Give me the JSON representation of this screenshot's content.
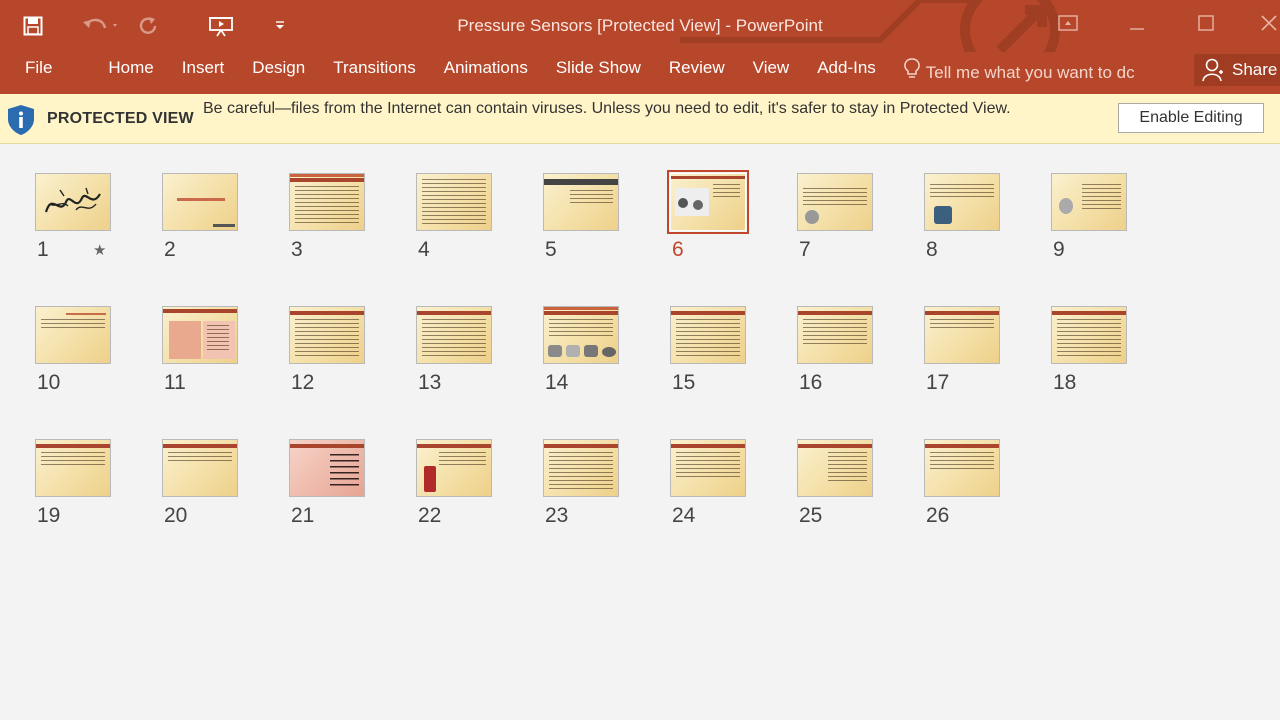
{
  "window": {
    "title": "Pressure Sensors [Protected View] - PowerPoint"
  },
  "ribbon": {
    "tabs": [
      "File",
      "Home",
      "Insert",
      "Design",
      "Transitions",
      "Animations",
      "Slide Show",
      "Review",
      "View",
      "Add-Ins"
    ],
    "tell_me_placeholder": "Tell me what you want to dc",
    "share_label": "Share"
  },
  "protected_view": {
    "label": "PROTECTED VIEW",
    "message": "Be careful—files from the Internet can contain viruses. Unless you need to edit, it's safer to stay in Protected View.",
    "enable_label": "Enable Editing"
  },
  "slides": {
    "selected": 6,
    "numbers": [
      "1",
      "2",
      "3",
      "4",
      "5",
      "6",
      "7",
      "8",
      "9",
      "10",
      "11",
      "12",
      "13",
      "14",
      "15",
      "16",
      "17",
      "18",
      "19",
      "20",
      "21",
      "22",
      "23",
      "24",
      "25",
      "26"
    ],
    "animation_marker": "★"
  },
  "colors": {
    "brand": "#b7472a",
    "protected_bar": "#fff5c9",
    "selected_accent": "#c0472c"
  },
  "icons": [
    "save-icon",
    "undo-icon",
    "redo-icon",
    "present-from-start-icon",
    "customize-qat-icon",
    "ribbon-display-icon",
    "minimize-icon",
    "maximize-icon",
    "close-icon",
    "lightbulb-icon",
    "person-icon",
    "shield-info-icon",
    "star-icon"
  ]
}
